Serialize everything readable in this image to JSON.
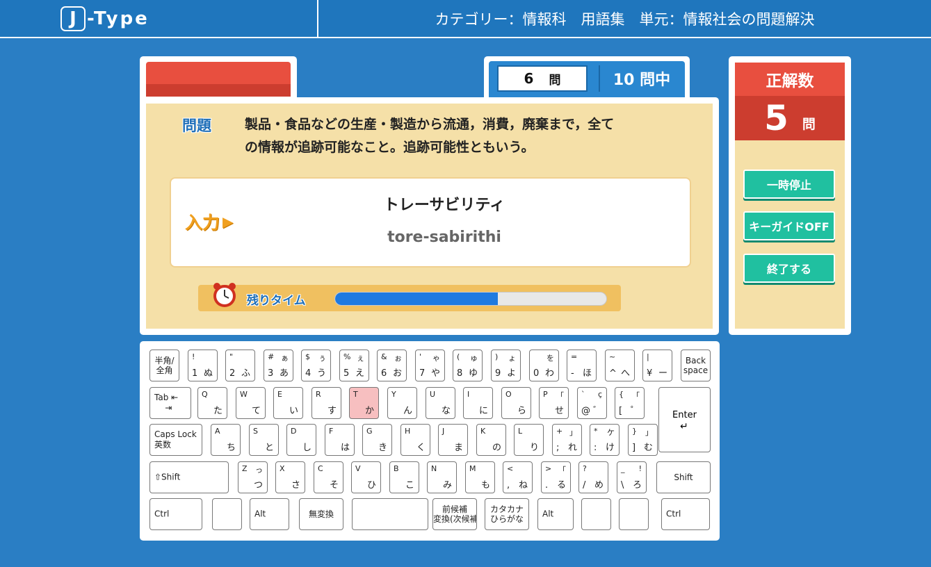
{
  "header": {
    "logo_box": "J",
    "logo_text": "-Type",
    "category": "カテゴリー：情報科　用語集　単元：情報社会の問題解決"
  },
  "question_counter": {
    "current": "6",
    "unit": "問",
    "total": "10 問中"
  },
  "question": {
    "label": "問題",
    "text_line1": "製品・食品などの生産・製造から流通，消費，廃棄まで，全て",
    "text_line2": "の情報が追跡可能なこと。追跡可能性ともいう。"
  },
  "answer": {
    "input_label": "入力",
    "kana": "トレーサビリティ",
    "romaji": "tore-sabirithi"
  },
  "timer": {
    "label": "残りタイム",
    "remaining_fraction": 0.6
  },
  "score": {
    "title": "正解数",
    "value": "5",
    "unit": "問"
  },
  "buttons": {
    "pause": "一時停止",
    "keyguide": "キーガイドOFF",
    "quit": "終了する"
  },
  "keyboard": {
    "highlighted_key": "T",
    "row1": [
      {
        "center": "半角/\n全角"
      },
      {
        "tl": "!",
        "bl": "1",
        "br": "ぬ"
      },
      {
        "tl": "\"",
        "bl": "2",
        "br": "ふ"
      },
      {
        "tl": "#",
        "tr": "ぁ",
        "bl": "3",
        "br": "あ"
      },
      {
        "tl": "$",
        "tr": "ぅ",
        "bl": "4",
        "br": "う"
      },
      {
        "tl": "%",
        "tr": "ぇ",
        "bl": "5",
        "br": "え"
      },
      {
        "tl": "&",
        "tr": "ぉ",
        "bl": "6",
        "br": "お"
      },
      {
        "tl": "'",
        "tr": "ゃ",
        "bl": "7",
        "br": "や"
      },
      {
        "tl": "(",
        "tr": "ゅ",
        "bl": "8",
        "br": "ゆ"
      },
      {
        "tl": ")",
        "tr": "ょ",
        "bl": "9",
        "br": "よ"
      },
      {
        "tr": "を",
        "bl": "0",
        "br": "わ"
      },
      {
        "tl": "=",
        "bl": "-",
        "br": "ほ"
      },
      {
        "tl": "~",
        "bl": "^",
        "br": "へ"
      },
      {
        "tl": "|",
        "bl": "¥",
        "br": "ー"
      },
      {
        "center": "Back\nspace"
      }
    ],
    "row2": [
      {
        "left": "Tab ⇤\n    ⇥"
      },
      {
        "tl": "Q",
        "br": "た"
      },
      {
        "tl": "W",
        "br": "て"
      },
      {
        "tl": "E",
        "br": "い"
      },
      {
        "tl": "R",
        "br": "す"
      },
      {
        "tl": "T",
        "br": "か"
      },
      {
        "tl": "Y",
        "br": "ん"
      },
      {
        "tl": "U",
        "br": "な"
      },
      {
        "tl": "I",
        "br": "に"
      },
      {
        "tl": "O",
        "br": "ら"
      },
      {
        "tl": "P",
        "tr": "「",
        "br": "せ"
      },
      {
        "tl": "`",
        "tr": "ç",
        "bl": "@",
        "br": "゛"
      },
      {
        "tl": "{",
        "tr": "「",
        "bl": "[",
        "br": "゜"
      }
    ],
    "enter": "Enter",
    "row3": [
      {
        "left": "Caps Lock\n英数"
      },
      {
        "tl": "A",
        "br": "ち"
      },
      {
        "tl": "S",
        "br": "と"
      },
      {
        "tl": "D",
        "br": "し"
      },
      {
        "tl": "F",
        "br": "は"
      },
      {
        "tl": "G",
        "br": "き"
      },
      {
        "tl": "H",
        "br": "く"
      },
      {
        "tl": "J",
        "br": "ま"
      },
      {
        "tl": "K",
        "br": "の"
      },
      {
        "tl": "L",
        "br": "り"
      },
      {
        "tl": "+",
        "tr": "」",
        "bl": ";",
        "br": "れ"
      },
      {
        "tl": "*",
        "tr": "ケ",
        "bl": ":",
        "br": "け"
      },
      {
        "tl": "}",
        "tr": "」",
        "bl": "]",
        "br": "む"
      }
    ],
    "row4": [
      {
        "left": "⇧Shift"
      },
      {
        "tl": "Z",
        "tr": "っ",
        "br": "つ"
      },
      {
        "tl": "X",
        "br": "さ"
      },
      {
        "tl": "C",
        "br": "そ"
      },
      {
        "tl": "V",
        "br": "ひ"
      },
      {
        "tl": "B",
        "br": "こ"
      },
      {
        "tl": "N",
        "br": "み"
      },
      {
        "tl": "M",
        "br": "も"
      },
      {
        "tl": "<",
        "bl": ",",
        "br": "ね"
      },
      {
        "tl": ">",
        "tr": "「",
        "bl": ".",
        "br": "る"
      },
      {
        "tl": "?",
        "bl": "/",
        "br": "め"
      },
      {
        "tl": "_",
        "tr": "!",
        "bl": "\\",
        "br": "ろ"
      },
      {
        "center": "Shift"
      }
    ],
    "row5": [
      {
        "left": "Ctrl"
      },
      {
        "center": ""
      },
      {
        "left": "Alt"
      },
      {
        "center": "無変換"
      },
      {
        "center": ""
      },
      {
        "center": "前候補\n変換(次候補)"
      },
      {
        "center": "カタカナ\nひらがな"
      },
      {
        "left": "Alt"
      },
      {
        "center": ""
      },
      {
        "center": ""
      },
      {
        "left": "Ctrl"
      }
    ]
  }
}
